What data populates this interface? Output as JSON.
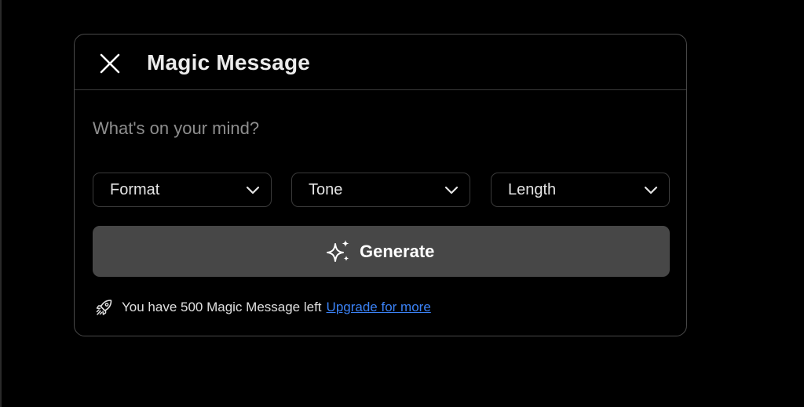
{
  "dialog": {
    "title": "Magic Message",
    "close_icon": "close-icon"
  },
  "prompt": {
    "placeholder": "What's on your mind?",
    "value": ""
  },
  "selects": [
    {
      "label": "Format",
      "icon": "chevron-down-icon"
    },
    {
      "label": "Tone",
      "icon": "chevron-down-icon"
    },
    {
      "label": "Length",
      "icon": "chevron-down-icon"
    }
  ],
  "generate": {
    "label": "Generate",
    "icon": "sparkle-icon"
  },
  "footer": {
    "icon": "rocket-icon",
    "quota_text": "You have 500 Magic Message left",
    "upgrade_link": "Upgrade for more"
  },
  "colors": {
    "background": "#000000",
    "button": "#474747",
    "border": "#4a4a4a",
    "link": "#3b82f6",
    "text": "#ececec"
  }
}
